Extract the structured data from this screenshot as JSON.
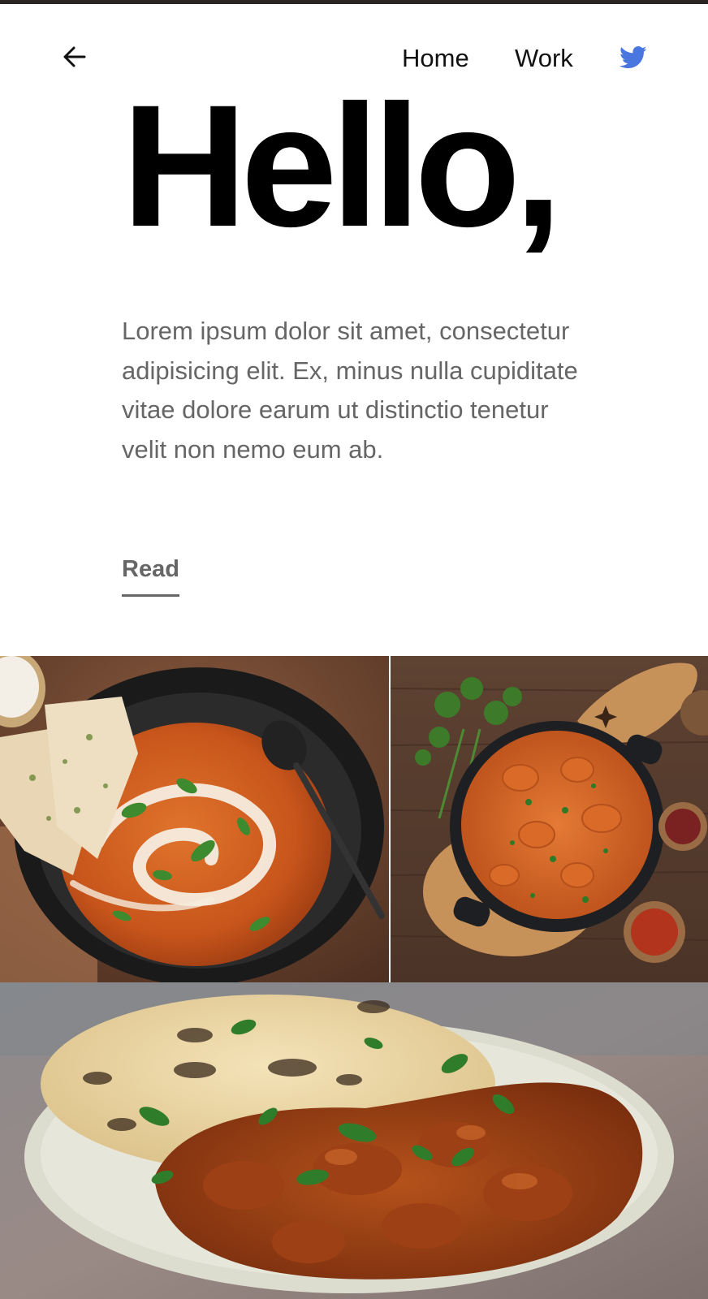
{
  "header": {
    "back_icon": "arrow-left-icon",
    "nav": [
      {
        "label": "Home"
      },
      {
        "label": "Work"
      }
    ],
    "twitter_icon": "twitter-bird-icon",
    "twitter_color": "#4A76E0"
  },
  "hero": {
    "title": "Hello,",
    "body": "Lorem ipsum dolor sit amet, consectetur adipisicing elit. Ex, minus nulla cupiditate vitae dolore earum ut distinctio tenetur velit non nemo eum ab.",
    "read_label": "Read"
  },
  "gallery": {
    "images": [
      {
        "subject": "curry-bowl-with-naan"
      },
      {
        "subject": "curry-pot-on-wooden-board"
      },
      {
        "subject": "curry-plate-with-naan"
      }
    ]
  }
}
